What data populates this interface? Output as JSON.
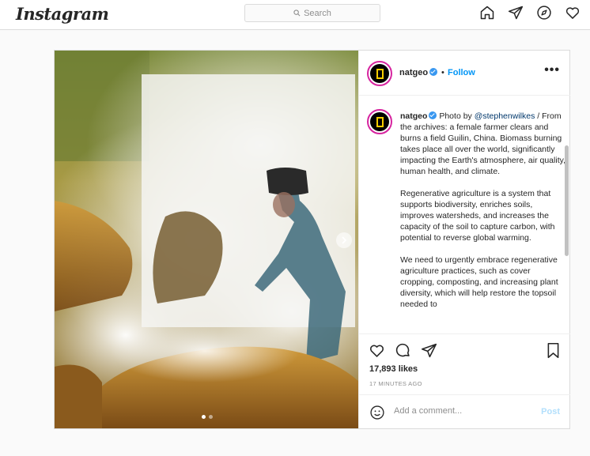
{
  "nav": {
    "logo": "Instagram",
    "search_placeholder": "Search",
    "icons": [
      "home-icon",
      "direct-icon",
      "explore-icon",
      "heart-icon"
    ]
  },
  "post": {
    "username": "natgeo",
    "separator": "•",
    "follow_label": "Follow",
    "more_label": "•••",
    "caption": {
      "username": "natgeo",
      "lead": " Photo by ",
      "mention": "@stephenwilkes",
      "p1_rest": " / From the archives: a female farmer clears and burns a field Guilin, China. Biomass burning takes place all over the world, significantly impacting the Earth's atmosphere, air quality, human health, and climate.",
      "p2": "Regenerative agriculture is a system that supports biodiversity, enriches soils, improves watersheds, and increases the capacity of the soil to capture carbon, with potential to reverse global warming.",
      "p3": "We need to urgently embrace regenerative agriculture practices, such as cover cropping, composting, and increasing plant diversity, which will help restore the topsoil needed to"
    },
    "likes": "17,893 likes",
    "timestamp": "17 MINUTES AGO",
    "comment_placeholder": "Add a comment...",
    "post_label": "Post",
    "carousel": {
      "total": 2,
      "current": 1
    }
  },
  "colors": {
    "accent": "#0095f6",
    "verified": "#3897f0",
    "avatar_ring": "#d6249f",
    "natgeo_yellow": "#ffce00"
  }
}
